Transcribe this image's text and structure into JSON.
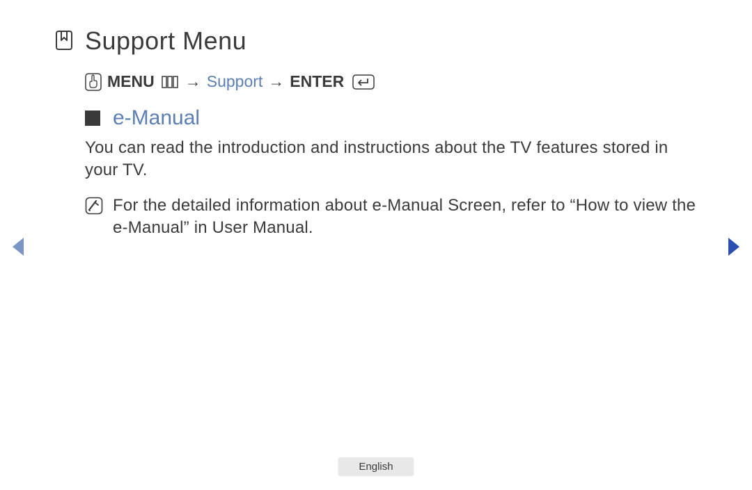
{
  "title": "Support Menu",
  "navPath": {
    "menu": "MENU",
    "arrow1": "→",
    "support": "Support",
    "arrow2": "→",
    "enter": "ENTER"
  },
  "section": {
    "heading": "e-Manual",
    "body": "You can read the introduction and instructions about the TV features stored in your TV.",
    "note": "For the detailed information about e-Manual Screen, refer to “How to view the e-Manual” in User Manual."
  },
  "language": "English"
}
